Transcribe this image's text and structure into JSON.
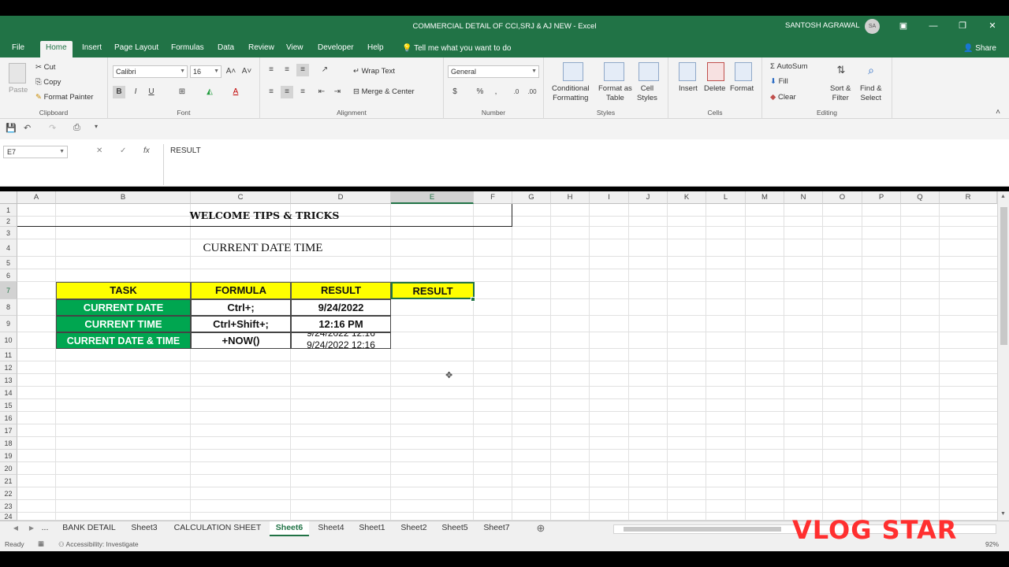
{
  "window": {
    "title": "COMMERCIAL DETAIL OF CCI,SRJ & AJ NEW  -  Excel",
    "user": "SANTOSH AGRAWAL",
    "user_initials": "SA"
  },
  "menu": {
    "tabs": [
      "File",
      "Home",
      "Insert",
      "Page Layout",
      "Formulas",
      "Data",
      "Review",
      "View",
      "Developer",
      "Help"
    ],
    "active": "Home",
    "tell_me": "Tell me what you want to do",
    "share": "Share"
  },
  "ribbon": {
    "clipboard": {
      "label": "Clipboard",
      "paste": "Paste",
      "cut": "Cut",
      "copy": "Copy",
      "format_painter": "Format Painter"
    },
    "font": {
      "label": "Font",
      "name": "Calibri",
      "size": "16"
    },
    "alignment": {
      "label": "Alignment",
      "wrap_text": "Wrap Text",
      "merge_center": "Merge & Center"
    },
    "number": {
      "label": "Number",
      "format": "General"
    },
    "styles": {
      "label": "Styles",
      "conditional": [
        "Conditional",
        "Formatting"
      ],
      "format_table": [
        "Format as",
        "Table"
      ],
      "cell_styles": [
        "Cell",
        "Styles"
      ]
    },
    "cells": {
      "label": "Cells",
      "insert": "Insert",
      "delete": "Delete",
      "format": "Format"
    },
    "editing": {
      "label": "Editing",
      "autosum": "AutoSum",
      "fill": "Fill",
      "clear": "Clear",
      "sort_filter": [
        "Sort &",
        "Filter"
      ],
      "find_select": [
        "Find &",
        "Select"
      ]
    }
  },
  "formula_bar": {
    "name_box": "E7",
    "content": "RESULT"
  },
  "grid": {
    "columns": [
      "A",
      "B",
      "C",
      "D",
      "E",
      "F",
      "G",
      "H",
      "I",
      "J",
      "K",
      "L",
      "M",
      "N",
      "O",
      "P",
      "Q",
      "R"
    ],
    "rows": [
      "1",
      "2",
      "3",
      "4",
      "5",
      "6",
      "7",
      "8",
      "9",
      "10",
      "11",
      "12",
      "13",
      "14",
      "15",
      "16",
      "17",
      "18",
      "19",
      "20",
      "21",
      "22",
      "23",
      "24"
    ],
    "selected_column": "E",
    "selected_row": "7"
  },
  "cells": {
    "welcome": "WELCOME TIPS & TRICKS",
    "current_date_time": "CURRENT DATE TIME",
    "headers": [
      "TASK",
      "FORMULA",
      "RESULT",
      "RESULT"
    ],
    "rows": [
      {
        "task": "CURRENT DATE",
        "formula": "Ctrl+;",
        "result": "9/24/2022"
      },
      {
        "task": "CURRENT TIME",
        "formula": "Ctrl+Shift+;",
        "result": "12:16 PM"
      },
      {
        "task": "CURRENT DATE & TIME",
        "formula": "+NOW()",
        "result": "9/24/2022 12:16"
      }
    ]
  },
  "sheet_tabs": {
    "more": "...",
    "tabs": [
      "BANK DETAIL",
      "Sheet3",
      "CALCULATION SHEET",
      "Sheet6",
      "Sheet4",
      "Sheet1",
      "Sheet2",
      "Sheet5",
      "Sheet7"
    ],
    "active": "Sheet6"
  },
  "status": {
    "ready": "Ready",
    "accessibility": "Accessibility: Investigate",
    "zoom": "92%"
  },
  "watermark": "VLOG STAR"
}
